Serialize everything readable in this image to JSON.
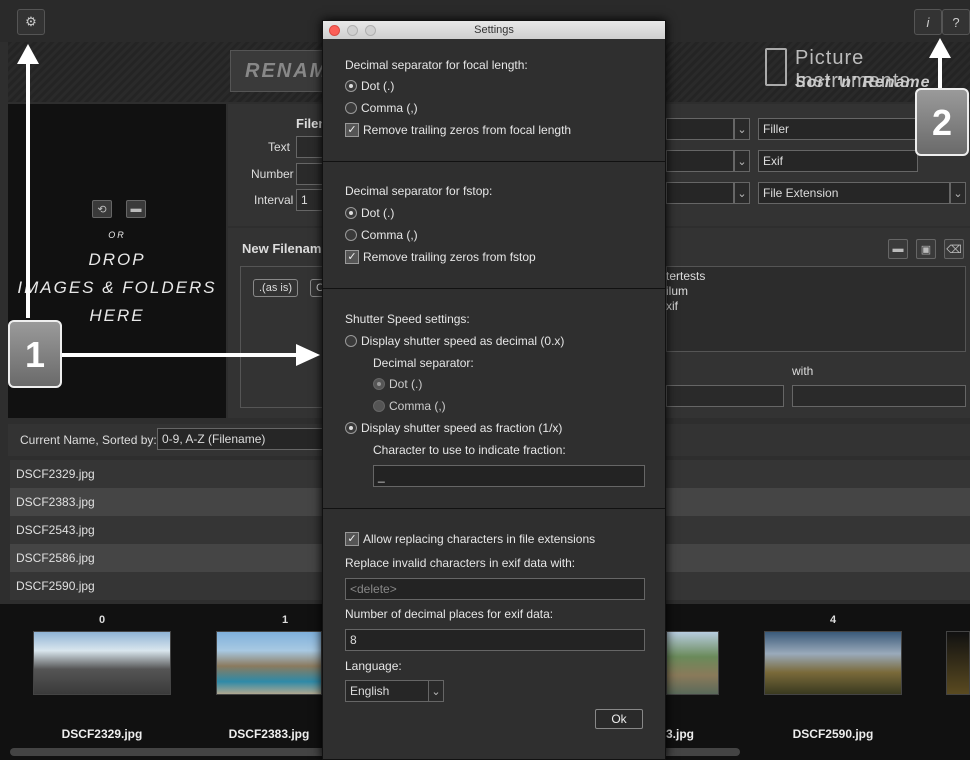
{
  "topbar": {
    "settings_icon": "gear-icon",
    "info_label": "i",
    "help_label": "?"
  },
  "banner": {
    "rename_text": "RENAME",
    "logo_line1": "Picture Instruments",
    "logo_line2": "Sort 'n' Rename"
  },
  "drop": {
    "or": "OR",
    "line1": "DROP",
    "line2": "IMAGES & FOLDERS",
    "line3": "HERE"
  },
  "filename": {
    "header": "Filen",
    "text_label": "Text",
    "number_label": "Number",
    "interval_label": "Interval",
    "interval_value": "1",
    "combo_right": [
      "Filler",
      "Exif",
      "File Extension"
    ]
  },
  "new_filename": {
    "header": "New Filenam",
    "token1": ".(as is)",
    "token2": "C",
    "preview_lines": [
      "tertests",
      "ilum",
      "xif"
    ],
    "with_label": "with"
  },
  "sort": {
    "label": "Current Name, Sorted by:",
    "value": "0-9, A-Z (Filename)"
  },
  "files": [
    "DSCF2329.jpg",
    "DSCF2383.jpg",
    "DSCF2543.jpg",
    "DSCF2586.jpg",
    "DSCF2590.jpg"
  ],
  "thumbs": [
    {
      "num": "0",
      "name": "DSCF2329.jpg"
    },
    {
      "num": "1",
      "name": "DSCF2383.jpg"
    },
    {
      "num": "",
      "name": "3.jpg"
    },
    {
      "num": "4",
      "name": "DSCF2590.jpg"
    }
  ],
  "dialog": {
    "title": "Settings",
    "focal": {
      "heading": "Decimal separator for focal length:",
      "dot": "Dot (.)",
      "comma": "Comma (,)",
      "trim": "Remove trailing zeros from focal length"
    },
    "fstop": {
      "heading": "Decimal separator for fstop:",
      "dot": "Dot (.)",
      "comma": "Comma (,)",
      "trim": "Remove trailing zeros from fstop"
    },
    "shutter": {
      "heading": "Shutter Speed settings:",
      "decimal": "Display shutter speed as decimal (0.x)",
      "sep_label": "Decimal separator:",
      "dot": "Dot (.)",
      "comma": "Comma (,)",
      "fraction": "Display shutter speed as fraction (1/x)",
      "char_label": "Character to use to indicate fraction:",
      "char_value": "_"
    },
    "misc": {
      "allow_ext": "Allow replacing characters in file extensions",
      "replace_label": "Replace invalid characters in exif data with:",
      "replace_placeholder": "<delete>",
      "decimals_label": "Number of decimal places for exif data:",
      "decimals_value": "8",
      "language_label": "Language:",
      "language_value": "English",
      "ok": "Ok"
    }
  },
  "callouts": {
    "one": "1",
    "two": "2"
  }
}
